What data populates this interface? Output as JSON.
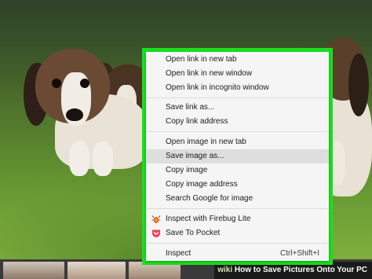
{
  "menu": {
    "group1": [
      {
        "label": "Open link in new tab"
      },
      {
        "label": "Open link in new window"
      },
      {
        "label": "Open link in incognito window"
      }
    ],
    "group2": [
      {
        "label": "Save link as..."
      },
      {
        "label": "Copy link address"
      }
    ],
    "group3": [
      {
        "label": "Open image in new tab"
      },
      {
        "label": "Save image as..."
      },
      {
        "label": "Copy image"
      },
      {
        "label": "Copy image address"
      },
      {
        "label": "Search Google for image"
      }
    ],
    "group4": [
      {
        "label": "Inspect with Firebug Lite",
        "icon": "firebug-icon"
      },
      {
        "label": "Save To Pocket",
        "icon": "pocket-icon"
      }
    ],
    "inspect": {
      "label": "Inspect",
      "shortcut": "Ctrl+Shift+I"
    },
    "highlighted_item": "Save image as...",
    "highlight_color": "#19e01f"
  },
  "caption": {
    "brand": "wiki",
    "title": "How to Save Pictures Onto Your PC"
  }
}
